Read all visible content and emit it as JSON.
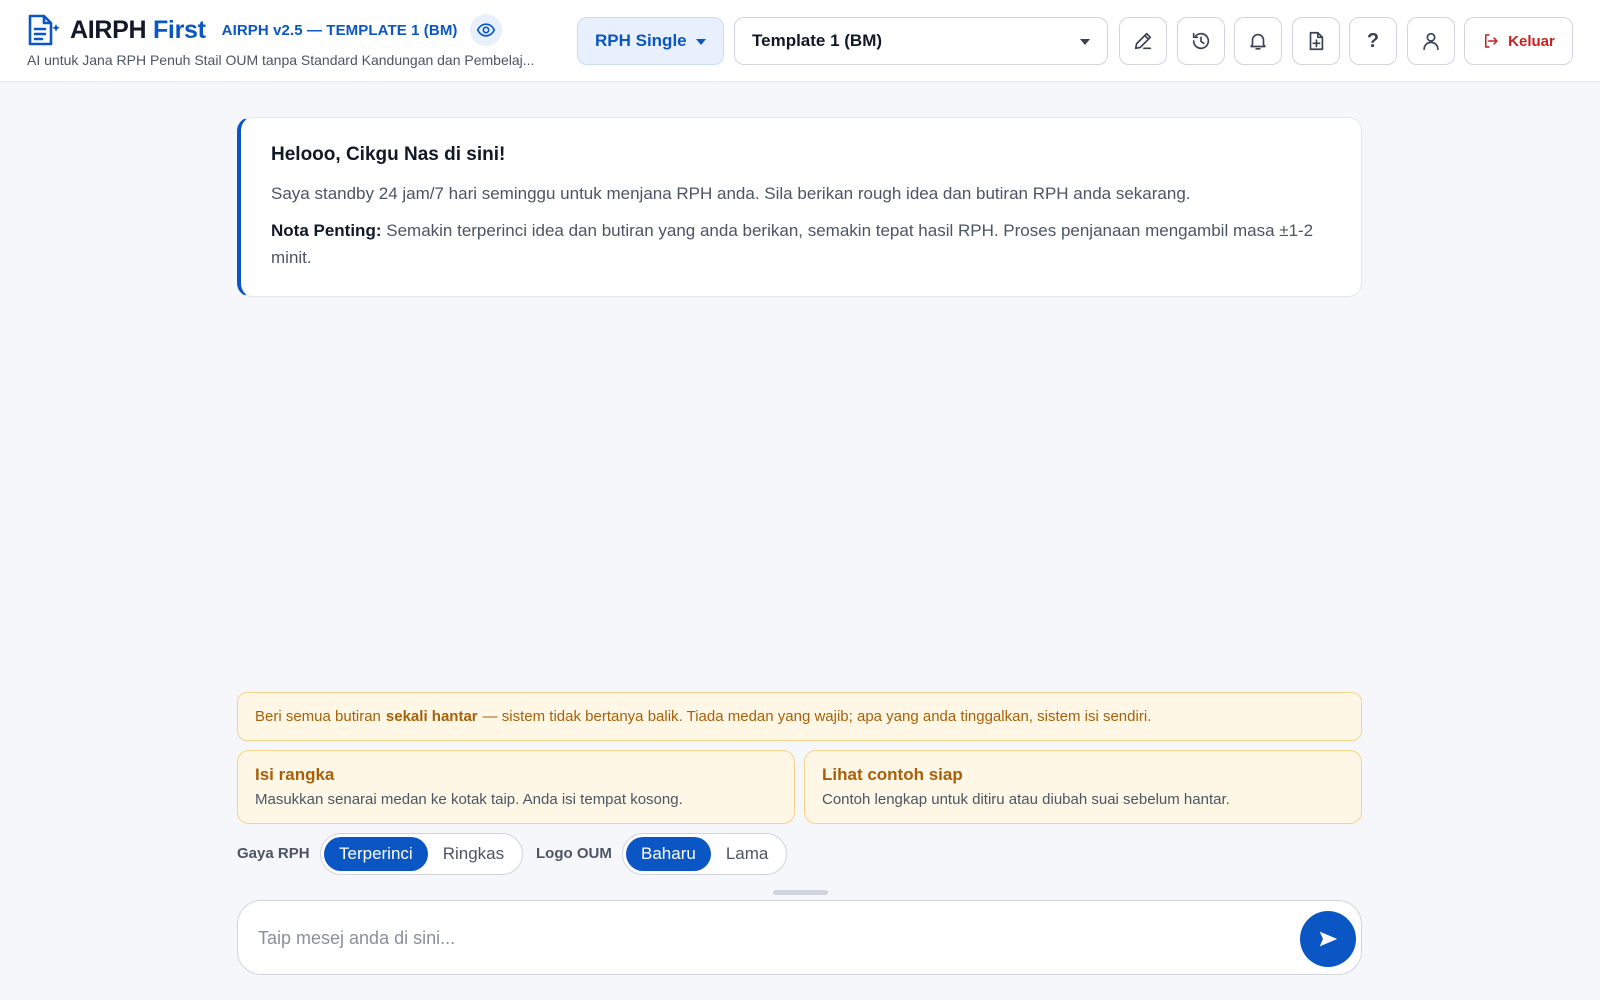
{
  "colors": {
    "brand": "#0a56c4",
    "danger": "#c81e1e",
    "warning_text": "#a8600a",
    "warning_bg": "#fff7e6"
  },
  "header": {
    "brand_main": "AIRPH",
    "brand_accent": "First",
    "version": "AIRPH v2.5 — TEMPLATE 1 (BM)",
    "subtitle": "AI untuk Jana RPH Penuh Stail OUM tanpa Standard Kandungan dan Pembelaj...",
    "mode_select": "RPH Single",
    "template_select": "Template 1 (BM)",
    "icons": [
      "edit-icon",
      "history-icon",
      "bell-icon",
      "file-plus-icon",
      "help-icon",
      "user-icon"
    ],
    "help_glyph": "?",
    "logout_label": "Keluar"
  },
  "welcome": {
    "title": "Helooo, Cikgu Nas di sini!",
    "text": "Saya standby 24 jam/7 hari seminggu untuk menjana RPH anda. Sila berikan rough idea dan butiran RPH anda sekarang.",
    "note_label": "Nota Penting:",
    "note_text": "Semakin terperinci idea dan butiran yang anda berikan, semakin tepat hasil RPH. Proses penjanaan mengambil masa ±1-2 minit."
  },
  "tip": {
    "before": "Beri semua butiran",
    "bold": "sekali hantar",
    "after": "— sistem tidak bertanya balik. Tiada medan yang wajib; apa yang anda tinggalkan, sistem isi sendiri."
  },
  "options": [
    {
      "title": "Isi rangka",
      "desc": "Masukkan senarai medan ke kotak taip. Anda isi tempat kosong."
    },
    {
      "title": "Lihat contoh siap",
      "desc": "Contoh lengkap untuk ditiru atau diubah suai sebelum hantar."
    }
  ],
  "toggles": {
    "style": {
      "label": "Gaya RPH",
      "options": [
        "Terperinci",
        "Ringkas"
      ],
      "selected": "Terperinci"
    },
    "logo": {
      "label": "Logo OUM",
      "options": [
        "Baharu",
        "Lama"
      ],
      "selected": "Baharu"
    }
  },
  "composer": {
    "placeholder": "Taip mesej anda di sini...",
    "value": ""
  }
}
